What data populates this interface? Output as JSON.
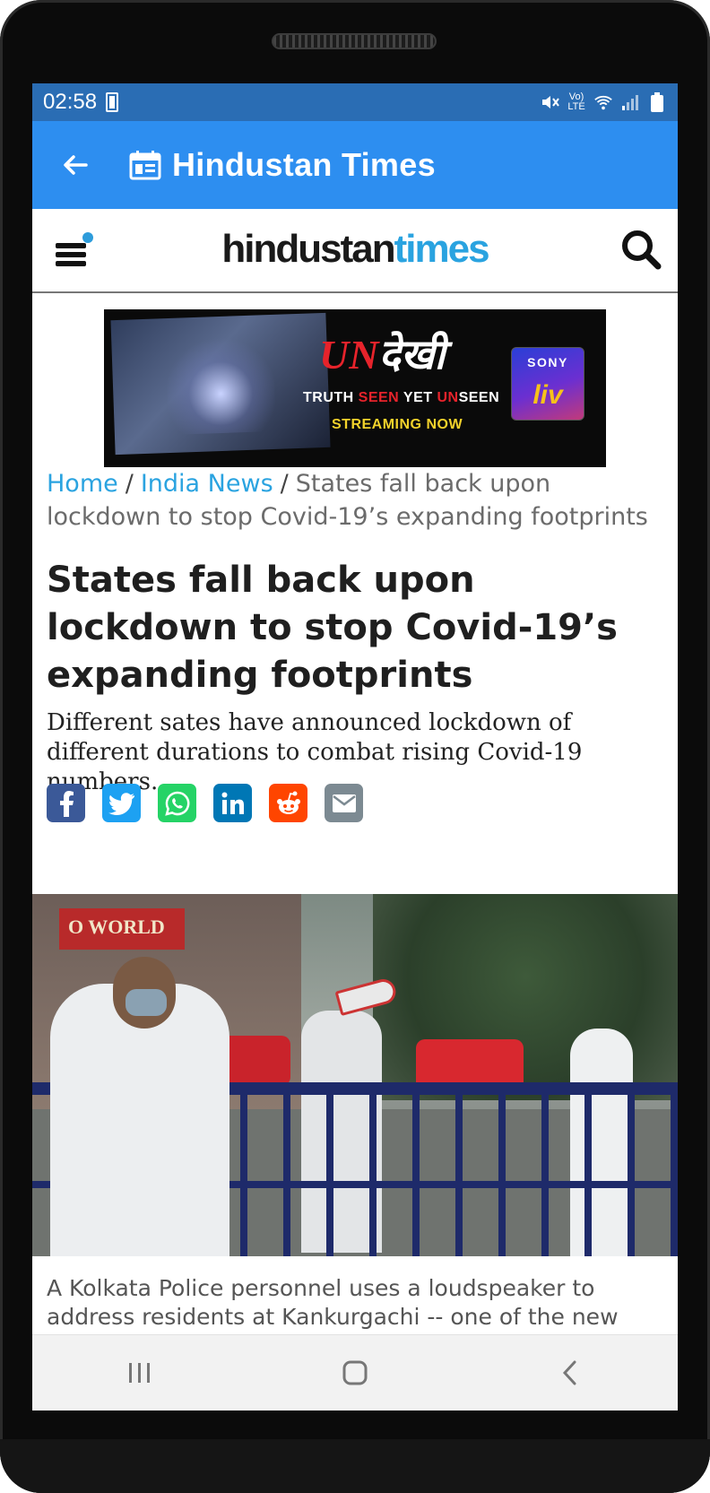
{
  "status_bar": {
    "time": "02:58",
    "battery_level_text": "100",
    "network_label_top": "Vo)",
    "network_label_bottom": "LTE",
    "bg_color": "#2a6db4"
  },
  "app_bar": {
    "title": "Hindustan Times",
    "bg_color": "#2d8ef0",
    "back_icon": "arrow-left-icon",
    "app_icon": "calendar-news-icon"
  },
  "site_header": {
    "logo_part1": "hindustan",
    "logo_part2": "times",
    "menu_icon": "hamburger-menu-icon",
    "search_icon": "search-icon",
    "accent_color": "#2aa3e0"
  },
  "ad": {
    "title_latin": "UN",
    "title_devanagari": "देखी",
    "line1_a": "TRUTH ",
    "line1_b": "SEEN",
    "line1_c": " YET ",
    "line1_d": "UN",
    "line1_e": "SEEN",
    "line2": "STREAMING NOW",
    "brand_top": "SONY",
    "brand_bottom": "liv"
  },
  "breadcrumb": {
    "home": "Home",
    "section": "India News",
    "separator": "/",
    "current": "States fall back upon lockdown to stop Covid-19’s expanding footprints"
  },
  "article": {
    "headline": "States fall back upon lockdown to stop Covid-19’s expanding footprints",
    "summary": "Different sates have announced lockdown of different durations to combat rising Covid-19 numbers.",
    "photo_sign_text": "O WORLD",
    "caption": "A Kolkata Police personnel uses a loudspeaker to address residents at Kankurgachi -- one of the new"
  },
  "share": [
    {
      "name": "facebook",
      "icon": "facebook-icon",
      "glyph": "f",
      "color": "#3b5998"
    },
    {
      "name": "twitter",
      "icon": "twitter-icon",
      "glyph": "t",
      "color": "#1da1f2"
    },
    {
      "name": "whatsapp",
      "icon": "whatsapp-icon",
      "glyph": "w",
      "color": "#25d366"
    },
    {
      "name": "linkedin",
      "icon": "linkedin-icon",
      "glyph": "in",
      "color": "#0077b5"
    },
    {
      "name": "reddit",
      "icon": "reddit-icon",
      "glyph": "r",
      "color": "#ff4500"
    },
    {
      "name": "email",
      "icon": "email-icon",
      "glyph": "✉",
      "color": "#7c8a92"
    }
  ],
  "nav_bar": {
    "recents_icon": "recents-icon",
    "home_icon": "home-icon",
    "back_icon": "back-chevron-icon"
  }
}
